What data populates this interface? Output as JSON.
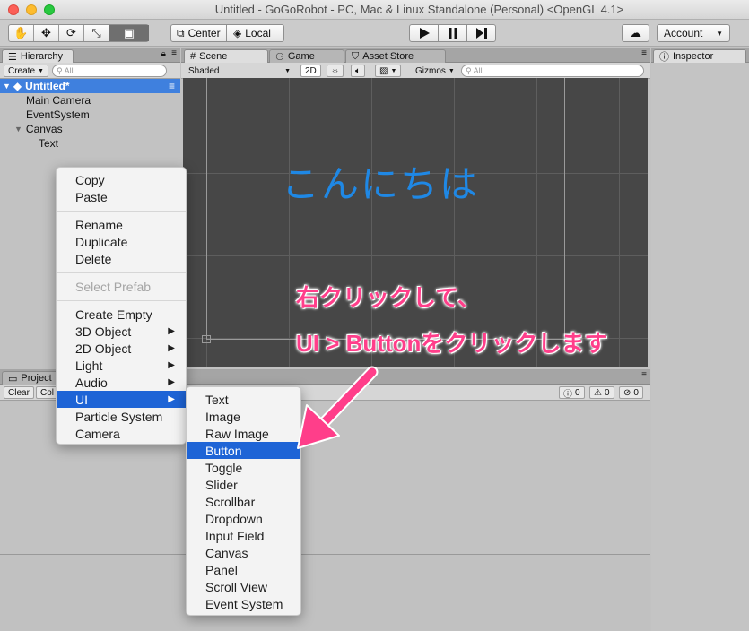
{
  "window": {
    "title": "Untitled - GoGoRobot - PC, Mac & Linux Standalone (Personal) <OpenGL 4.1>"
  },
  "toolbar": {
    "tools": [
      "hand-tool-icon",
      "move-tool-icon",
      "rotate-tool-icon",
      "scale-tool-icon",
      "rect-tool-icon"
    ],
    "center_label": "Center",
    "local_label": "Local",
    "account_label": "Account"
  },
  "hierarchy": {
    "tab_label": "Hierarchy",
    "create_label": "Create",
    "search_placeholder": "All",
    "scene_name": "Untitled*",
    "items": [
      "Main Camera",
      "EventSystem",
      "Canvas",
      "Text"
    ]
  },
  "scene": {
    "tabs": [
      "Scene",
      "Game",
      "Asset Store"
    ],
    "shading": "Shaded",
    "mode_2d": "2D",
    "gizmos": "Gizmos",
    "search_placeholder": "All",
    "canvas_text": "こんにちは"
  },
  "inspector": {
    "tab_label": "Inspector"
  },
  "project": {
    "tab_label": "Project",
    "clear_label": "Clear",
    "collapse_label": "Col",
    "counts": [
      "0",
      "0",
      "0"
    ]
  },
  "context_menu": {
    "items": [
      {
        "label": "Copy"
      },
      {
        "label": "Paste"
      },
      {
        "label": "Rename"
      },
      {
        "label": "Duplicate"
      },
      {
        "label": "Delete"
      },
      {
        "label": "Select Prefab",
        "disabled": true
      },
      {
        "label": "Create Empty"
      },
      {
        "label": "3D Object",
        "submenu": true
      },
      {
        "label": "2D Object",
        "submenu": true
      },
      {
        "label": "Light",
        "submenu": true
      },
      {
        "label": "Audio",
        "submenu": true
      },
      {
        "label": "UI",
        "submenu": true,
        "highlighted": true
      },
      {
        "label": "Particle System"
      },
      {
        "label": "Camera"
      }
    ]
  },
  "ui_submenu": {
    "items": [
      "Text",
      "Image",
      "Raw Image",
      "Button",
      "Toggle",
      "Slider",
      "Scrollbar",
      "Dropdown",
      "Input Field",
      "Canvas",
      "Panel",
      "Scroll View",
      "Event System"
    ],
    "highlighted": "Button"
  },
  "annotation": {
    "line1": "右クリックして、",
    "line2": "UI > Buttonをクリックします",
    "color": "#ff3e8a"
  },
  "colors": {
    "highlight": "#1e64d6",
    "scene_bg": "#474747",
    "canvas_text": "#1f88e5"
  }
}
